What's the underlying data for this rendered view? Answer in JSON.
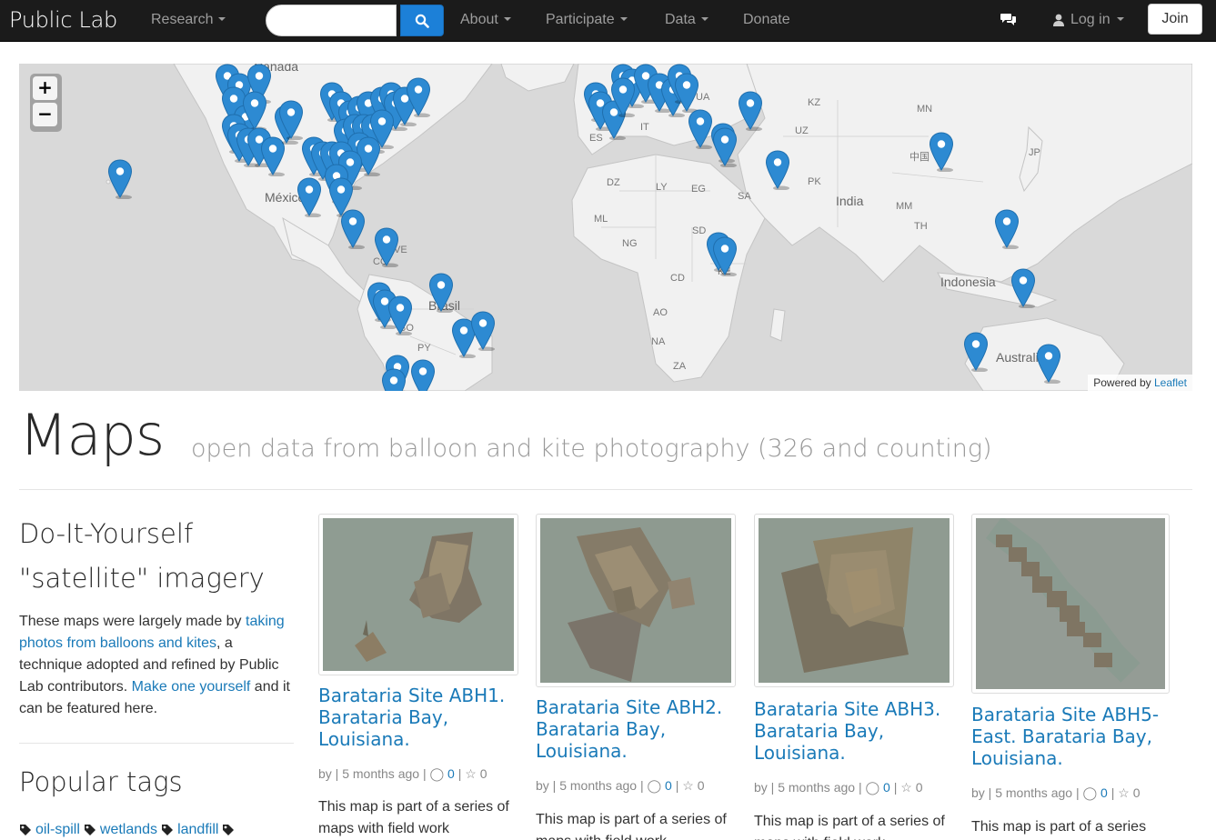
{
  "navbar": {
    "brand": "Public Lab",
    "items": [
      {
        "label": "Research",
        "dropdown": true
      },
      {
        "label": "About",
        "dropdown": true
      },
      {
        "label": "Participate",
        "dropdown": true
      },
      {
        "label": "Data",
        "dropdown": true
      },
      {
        "label": "Donate",
        "dropdown": false
      }
    ],
    "search": {
      "placeholder": "",
      "icon": "search-icon"
    },
    "chat_icon": "chat-icon",
    "login_label": "Log in",
    "join_label": "Join",
    "accent_color": "#1c80d8"
  },
  "map": {
    "zoom_in": "+",
    "zoom_out": "−",
    "attribution_prefix": "Powered by",
    "attribution_link": "Leaflet",
    "labels": [
      "Canada",
      "México",
      "VE",
      "CO",
      "Brasil",
      "BO",
      "PY",
      "DZ",
      "LY",
      "EG",
      "ML",
      "NG",
      "CD",
      "AO",
      "NA",
      "ZA",
      "SD",
      "ET",
      "KE",
      "SA",
      "UA",
      "KZ",
      "UZ",
      "MN",
      "PK",
      "India",
      "TH",
      "MM",
      "Indonesia",
      "Australia",
      "JP",
      "IT",
      "ES",
      "中国"
    ],
    "marker_color": "#2d8ad2"
  },
  "header": {
    "title": "Maps",
    "subtitle": "open data from balloon and kite photography (326 and counting)"
  },
  "sidebar": {
    "diy_title": "Do-It-Yourself \"satellite\" imagery",
    "text_1": "These maps were largely made by ",
    "link_1": "taking photos from balloons and kites",
    "text_2": ", a technique adopted and refined by Public Lab contributors. ",
    "link_2": "Make one yourself",
    "text_3": " and it can be featured here.",
    "popular_title": "Popular tags",
    "tags": [
      "oil-spill",
      "wetlands",
      "landfill"
    ]
  },
  "cards": [
    {
      "title": "Barataria Site ABH1. Barataria Bay, Louisiana.",
      "by": "by",
      "time": "5 months ago",
      "comments": "0",
      "stars": "0",
      "desc": "This map is part of a series of maps with field work"
    },
    {
      "title": "Barataria Site ABH2. Barataria Bay, Louisiana.",
      "by": "by",
      "time": "5 months ago",
      "comments": "0",
      "stars": "0",
      "desc": "This map is part of a series of maps with field work"
    },
    {
      "title": "Barataria Site ABH3. Barataria Bay, Louisiana.",
      "by": "by",
      "time": "5 months ago",
      "comments": "0",
      "stars": "0",
      "desc": "This map is part of a series of maps with field work"
    },
    {
      "title": "Barataria Site ABH5-East. Barataria Bay, Louisiana.",
      "by": "by",
      "time": "5 months ago",
      "comments": "0",
      "stars": "0",
      "desc": "This map is part of a series"
    }
  ]
}
